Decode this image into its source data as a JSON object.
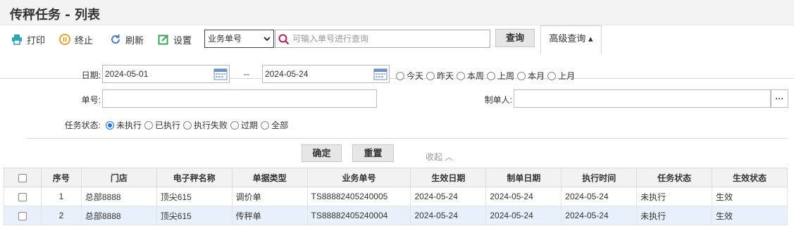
{
  "title": "传秤任务 - 列表",
  "toolbar": {
    "print_label": "打印",
    "stop_label": "终止",
    "refresh_label": "刷新",
    "settings_label": "设置",
    "search_type_selected": "业务单号",
    "search_placeholder": "可输入单号进行查询",
    "query_label": "查询",
    "advanced_label": "高级查询 ▴"
  },
  "colors": {
    "accent_orange": "#f0a030",
    "accent_teal": "#2aa7b4",
    "accent_blue": "#4a7ec9",
    "accent_green": "#3aa757",
    "search_icon": "#c2185b",
    "calendar": "#6a8fc7",
    "radio_on": "#1a73e8"
  },
  "filters": {
    "date_label": "日期:",
    "date_from": "2024-05-01",
    "date_sep": "--",
    "date_to": "2024-05-24",
    "quick_dates": [
      "今天",
      "昨天",
      "本周",
      "上周",
      "本月",
      "上月"
    ],
    "order_no_label": "单号:",
    "order_no_value": "",
    "creator_label": "制单人:",
    "creator_value": "",
    "creator_more": "···",
    "status_label": "任务状态:",
    "status_options": [
      "未执行",
      "已执行",
      "执行失败",
      "过期",
      "全部"
    ],
    "status_selected": 0,
    "confirm_label": "确定",
    "reset_label": "重置",
    "collapse_label": "收起 ︿"
  },
  "table": {
    "columns": [
      "序号",
      "门店",
      "电子秤名称",
      "单据类型",
      "业务单号",
      "生效日期",
      "制单日期",
      "执行时间",
      "任务状态",
      "生效状态"
    ],
    "rows": [
      [
        "1",
        "总部8888",
        "顶尖615",
        "调价单",
        "TS88882405240005",
        "2024-05-24",
        "2024-05-24",
        "2024-05-24",
        "未执行",
        "生效"
      ],
      [
        "2",
        "总部8888",
        "顶尖615",
        "传秤单",
        "TS88882405240004",
        "2024-05-24",
        "2024-05-24",
        "2024-05-24",
        "未执行",
        "生效"
      ]
    ],
    "selected_row": 1
  }
}
